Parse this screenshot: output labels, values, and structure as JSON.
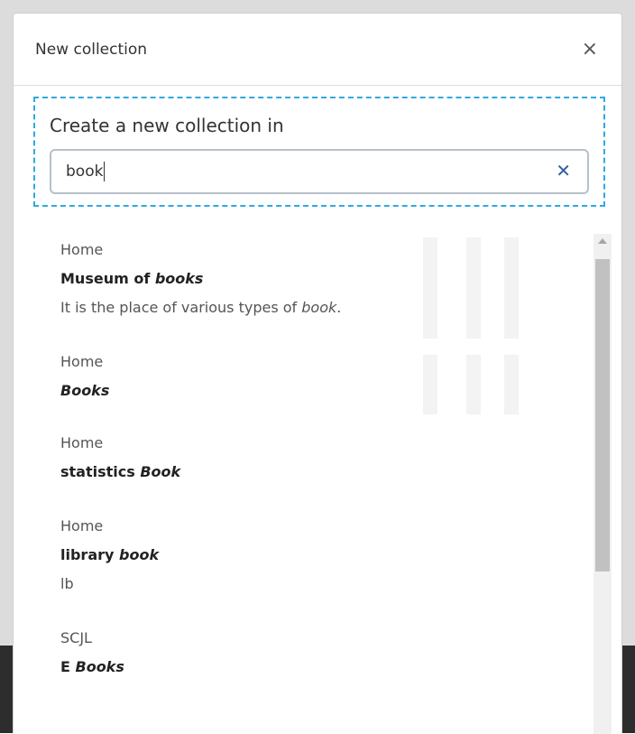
{
  "modal": {
    "title": "New collection",
    "close_symbol": "×"
  },
  "target": {
    "label": "Create a new collection in"
  },
  "search": {
    "value": "book",
    "clear_symbol": "✕"
  },
  "results": [
    {
      "path": "Home",
      "title_parts": [
        {
          "text": "Museum of ",
          "italic": false
        },
        {
          "text": "books",
          "italic": true
        }
      ],
      "description_parts": [
        {
          "text": "It is the place of various types of ",
          "italic": false
        },
        {
          "text": "book",
          "italic": true
        },
        {
          "text": ".",
          "italic": false
        }
      ]
    },
    {
      "path": "Home",
      "title_parts": [
        {
          "text": "Books",
          "italic": true
        }
      ],
      "description_parts": []
    },
    {
      "path": "Home",
      "title_parts": [
        {
          "text": "statistics ",
          "italic": false
        },
        {
          "text": "Book",
          "italic": true
        }
      ],
      "description_parts": []
    },
    {
      "path": "Home",
      "title_parts": [
        {
          "text": "library ",
          "italic": false
        },
        {
          "text": "book",
          "italic": true
        }
      ],
      "description_parts": [
        {
          "text": "lb",
          "italic": false
        }
      ]
    },
    {
      "path": "SCJL",
      "title_parts": [
        {
          "text": "E ",
          "italic": false
        },
        {
          "text": "Books",
          "italic": true
        }
      ],
      "description_parts": []
    }
  ],
  "icons": {
    "close": "close-icon",
    "clear": "clear-search-icon",
    "scroll_up": "scroll-up-arrow-icon"
  },
  "colors": {
    "dashed_border": "#2fa9e0",
    "clear_icon": "#2f5f9e",
    "scroll_thumb": "#c1c1c1"
  }
}
